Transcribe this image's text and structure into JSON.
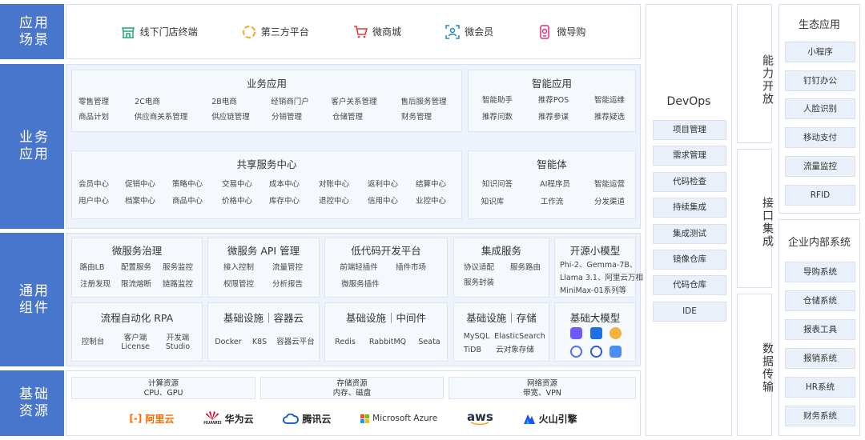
{
  "layers": {
    "scenarios": "应用场景",
    "business": "业务应用",
    "common": "通用组件",
    "infra": "基础资源"
  },
  "scenarios": [
    {
      "label": "线下门店终端",
      "icon": "store-icon"
    },
    {
      "label": "第三方平台",
      "icon": "circle-dashed-icon"
    },
    {
      "label": "微商城",
      "icon": "cart-icon"
    },
    {
      "label": "微会员",
      "icon": "member-icon"
    },
    {
      "label": "微导购",
      "icon": "guide-phone-icon"
    }
  ],
  "biz_apps": {
    "title": "业务应用",
    "row1": [
      "零售管理",
      "2C电商",
      "2B电商",
      "经销商门户",
      "客户关系管理",
      "售后服务管理"
    ],
    "row2": [
      "商品计划",
      "供应商关系管理",
      "供应链管理",
      "分销管理",
      "仓储管理",
      "财务管理"
    ]
  },
  "smart_apps": {
    "title": "智能应用",
    "row1": [
      "智能助手",
      "推荐POS",
      "智能运维"
    ],
    "row2": [
      "推荐问数",
      "推荐参谋",
      "推荐疑选"
    ]
  },
  "shared_center": {
    "title": "共享服务中心",
    "row1": [
      "会员中心",
      "促销中心",
      "策略中心",
      "交易中心",
      "成本中心",
      "对账中心",
      "返利中心",
      "结算中心"
    ],
    "row2": [
      "用户中心",
      "档案中心",
      "商品中心",
      "价格中心",
      "库存中心",
      "退控中心",
      "信用中心",
      "业控中心"
    ]
  },
  "agents": {
    "title": "智能体",
    "row1": [
      "知识问答",
      "AI程序员",
      "智能运营"
    ],
    "row2": [
      "知识库",
      "工作流",
      "分发渠道"
    ]
  },
  "common": {
    "microservice_gov": {
      "title": "微服务治理",
      "row1": [
        "路由LB",
        "配置服务",
        "服务监控"
      ],
      "row2": [
        "注册发现",
        "限流熔断",
        "链路监控"
      ]
    },
    "microservice_api": {
      "title": "微服务 API 管理",
      "row1": [
        "接入控制",
        "流量管控"
      ],
      "row2": [
        "权限管控",
        "分析报告"
      ]
    },
    "lowcode": {
      "title": "低代码开发平台",
      "row1": [
        "前端轻插件",
        "插件市场"
      ],
      "row2": [
        "微服务插件"
      ]
    },
    "integration": {
      "title": "集成服务",
      "row1": [
        "协议适配",
        "服务路由"
      ],
      "row2": [
        "服务封装"
      ]
    },
    "open_models": {
      "title": "开源小模型",
      "lines": [
        "Phi-2、Gemma-7B、",
        "Llama 3.1、阿里云万相",
        "MiniMax-01系列等"
      ]
    },
    "rpa": {
      "title": "流程自动化 RPA",
      "items": [
        "控制台",
        "客户端\nLicense",
        "开发端\nStudio"
      ]
    },
    "infra_container": {
      "title": "基础设施｜容器云",
      "items": [
        "Docker",
        "K8S",
        "容器云平台"
      ]
    },
    "infra_middleware": {
      "title": "基础设施｜中间件",
      "items": [
        "Redis",
        "RabbitMQ",
        "Seata"
      ]
    },
    "infra_storage": {
      "title": "基础设施｜存储",
      "row1": [
        "MySQL",
        "ElasticSearch"
      ],
      "row2": [
        "TiDB",
        "云对象存储"
      ]
    },
    "base_models": {
      "title": "基础大模型"
    }
  },
  "resources": [
    {
      "title": "计算资源",
      "sub": "CPU、GPU"
    },
    {
      "title": "存储资源",
      "sub": "内存、磁盘"
    },
    {
      "title": "网络资源",
      "sub": "带宽、VPN"
    }
  ],
  "clouds": [
    {
      "label": "阿里云",
      "color": "#ff6a00",
      "icon": "aliyun-logo"
    },
    {
      "label": "华为云",
      "color": "#cf0a2c",
      "icon": "huawei-logo"
    },
    {
      "label": "腾讯云",
      "color": "#0052d9",
      "icon": "tencent-cloud-logo"
    },
    {
      "label": "Microsoft Azure",
      "color": "#333333",
      "icon": "microsoft-logo"
    },
    {
      "label": "aws",
      "color": "#232f3e",
      "icon": "aws-logo"
    },
    {
      "label": "火山引擎",
      "color": "#1f4fff",
      "icon": "volcano-engine-logo"
    }
  ],
  "huawei_sub": "HUAWEI",
  "devops": {
    "title": "DevOps",
    "items": [
      "项目管理",
      "需求管理",
      "代码检查",
      "持续集成",
      "集成测试",
      "镜像仓库",
      "代码仓库",
      "IDE"
    ]
  },
  "vertical": {
    "open": "能力开放",
    "integrate": "接口集成",
    "transfer": "数据传输"
  },
  "eco": {
    "title": "生态应用",
    "items": [
      "小程序",
      "钉钉办公",
      "人脸识别",
      "移动支付",
      "流量监控",
      "RFID"
    ]
  },
  "internal": {
    "title": "企业内部系统",
    "items": [
      "导购系统",
      "仓储系统",
      "报表工具",
      "报销系统",
      "HR系统",
      "财务系统"
    ]
  }
}
